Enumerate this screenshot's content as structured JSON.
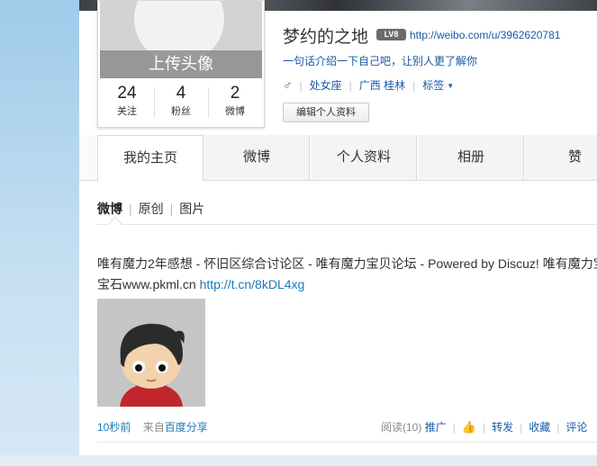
{
  "profile": {
    "avatar_upload_label": "上传头像",
    "name": "梦约的之地",
    "level_badge": "LV8",
    "url": "http://weibo.com/u/3962620781",
    "intro_link": "一句话介绍一下自己吧，让别人更了解你",
    "gender_symbol": "♂",
    "zodiac": "处女座",
    "location": "广西 桂林",
    "tags_label": "标签",
    "edit_button": "编辑个人资料",
    "stats": [
      {
        "value": "24",
        "label": "关注"
      },
      {
        "value": "4",
        "label": "粉丝"
      },
      {
        "value": "2",
        "label": "微博"
      }
    ]
  },
  "tabs": [
    "我的主页",
    "微博",
    "个人资料",
    "相册",
    "赞"
  ],
  "subtabs": [
    "微博",
    "原创",
    "图片"
  ],
  "post": {
    "text_line1": "唯有魔力2年感想 - 怀旧区综合讨论区 - 唯有魔力宝贝论坛 - Powered by Discuz! 唯有魔力宝",
    "text_line2_prefix": "宝石www.pkml.cn ",
    "short_link": "http://t.cn/8kDL4xg",
    "time": "10秒前",
    "source_prefix": "来自",
    "source": "百度分享",
    "read_count": "阅读(10)",
    "promote": "推广",
    "repost": "转发",
    "favorite": "收藏",
    "comment": "评论"
  }
}
